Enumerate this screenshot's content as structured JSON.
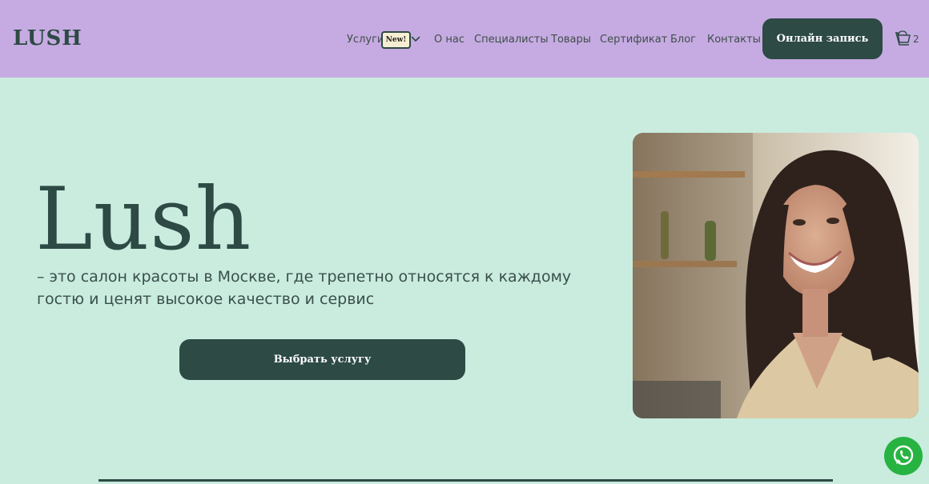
{
  "header": {
    "logo": "LUSH",
    "nav": {
      "services": "Услуги",
      "badge": "New!",
      "about": "О нас",
      "specialists": "Специалисты",
      "products": "Товары",
      "certificate": "Сертификат",
      "blog": "Блог",
      "contacts": "Контакты"
    },
    "cta_label": "Онлайн запись",
    "cart_count": "2"
  },
  "hero": {
    "title": "Lush",
    "subtitle": "– это салон красоты в Москве, где трепетно относятся к каждому гостю и ценят высокое качество и сервис",
    "button_label": "Выбрать услугу"
  },
  "colors": {
    "header_bg": "#c6abe2",
    "page_bg": "#c9ecdf",
    "accent": "#2d4a44",
    "whatsapp": "#27b341"
  },
  "icons": {
    "chevron": "chevron-down-icon",
    "cart": "cart-icon",
    "whatsapp": "whatsapp-icon"
  }
}
